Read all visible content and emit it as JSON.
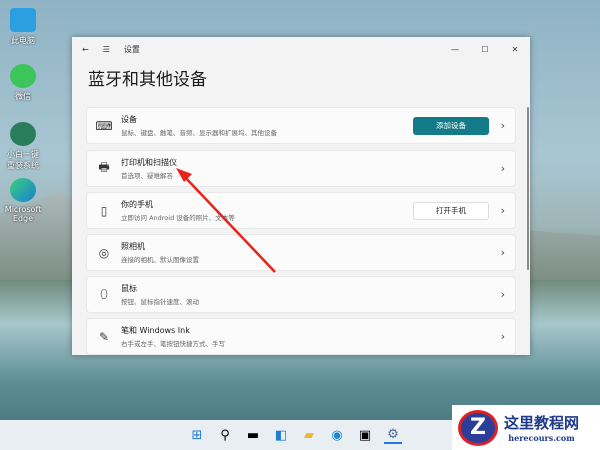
{
  "desktop": {
    "icons": [
      {
        "label": "此电脑"
      },
      {
        "label": "微信"
      },
      {
        "label": "小白一键重装系统"
      },
      {
        "label": "Microsoft Edge"
      }
    ]
  },
  "window": {
    "title": "设置",
    "heading": "蓝牙和其他设备",
    "cards": [
      {
        "title": "设备",
        "subtitle": "鼠标、键盘、触笔、音频、显示器和扩展坞、其他设备",
        "button": "添加设备",
        "icon": "devices-icon"
      },
      {
        "title": "打印机和扫描仪",
        "subtitle": "首选项、疑难解答",
        "icon": "printer-icon"
      },
      {
        "title": "你的手机",
        "subtitle": "立即访问 Android 设备的照片、文本等",
        "button": "打开手机",
        "icon": "phone-icon"
      },
      {
        "title": "照相机",
        "subtitle": "连接的相机、默认图像设置",
        "icon": "camera-icon"
      },
      {
        "title": "鼠标",
        "subtitle": "按钮、鼠标指针速度、滚动",
        "icon": "mouse-icon"
      },
      {
        "title": "笔和 Windows Ink",
        "subtitle": "右手或左手、笔按钮快捷方式、手写",
        "icon": "pen-icon"
      }
    ]
  },
  "colors": {
    "accent": "#137a88",
    "arrow": "#e8231a"
  },
  "watermark": {
    "name": "这里教程网",
    "url": "herecours.com",
    "logo": "Z"
  }
}
